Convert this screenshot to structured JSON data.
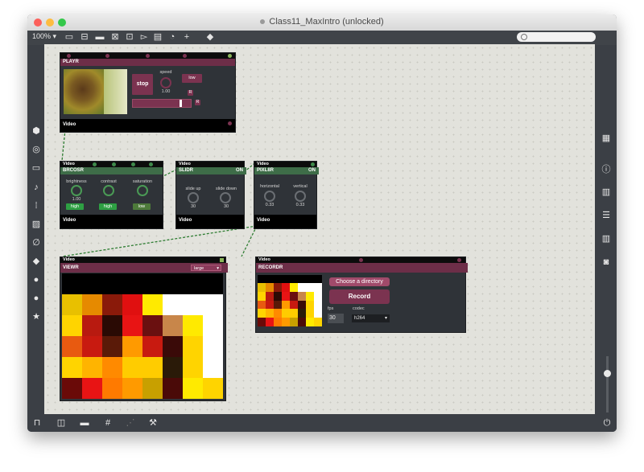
{
  "window": {
    "title": "Class11_MaxIntro (unlocked)",
    "zoom": "100%",
    "colors": {
      "accent": "#6d2e48",
      "green": "#3e6d48",
      "canvas": "#e2e2dc"
    }
  },
  "toolbar": {
    "icons": [
      "presentation-icon",
      "message-icon",
      "comment-icon",
      "object-icon",
      "number-icon",
      "toggle-icon",
      "slider-icon",
      "dial-icon",
      "add-icon",
      "paint-bucket-icon"
    ]
  },
  "left_sidebar": [
    "cube-icon",
    "target-icon",
    "video-icon",
    "music-note-icon",
    "step-icon",
    "image-icon",
    "paperclip-icon",
    "plug-icon",
    "vimeo-icon",
    "at-icon",
    "star-icon"
  ],
  "right_sidebar": [
    "grid-icon",
    "info-icon",
    "book-icon",
    "list-icon",
    "book-open-icon",
    "camera-icon"
  ],
  "bottombar": [
    "lock-icon",
    "windows-icon",
    "presentation-mode-icon",
    "grid-snap-icon",
    "wand-icon",
    "wrench-icon",
    "power-icon"
  ],
  "playr": {
    "title": "PLAYR",
    "stop": "stop",
    "speed_label": "speed",
    "speed_value": "1.00",
    "low_btn": "low",
    "r1": "R",
    "r2": "R",
    "video_label": "Video"
  },
  "brcosr": {
    "title": "BRCOSR",
    "video_label": "Video",
    "brightness": "brightness",
    "brightness_val": "1.00",
    "contrast": "contrast",
    "saturation": "saturation",
    "high1": "high",
    "high2": "high",
    "low": "low"
  },
  "slidr": {
    "title": "SLIDR",
    "on": "ON",
    "video_label": "Video",
    "slide_up": "slide up",
    "slide_down": "slide down",
    "up_val": "30",
    "down_val": "30"
  },
  "pixl8r": {
    "title": "PIXL8R",
    "on": "ON",
    "video_label": "Video",
    "horizontal": "horizontal",
    "vertical": "vertical",
    "h_val": "0.33",
    "v_val": "0.33"
  },
  "viewr": {
    "title": "VIEWR",
    "video_label": "Video",
    "size": "large"
  },
  "recordr": {
    "title": "RECORDR",
    "video_label": "Video",
    "choose": "Choose a directory",
    "record": "Record",
    "fps_label": "fps",
    "fps_val": "30",
    "codec_label": "codec",
    "codec_val": "h264"
  }
}
